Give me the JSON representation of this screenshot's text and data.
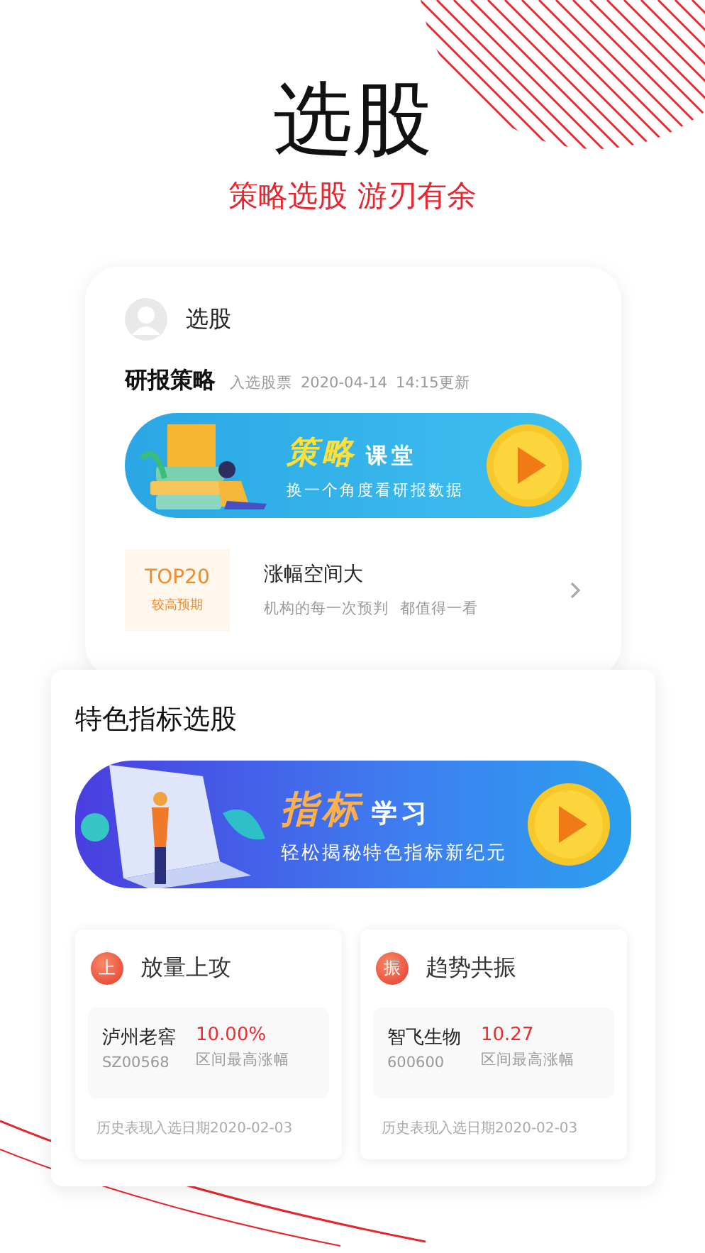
{
  "hero": {
    "title": "选股",
    "subtitle": "策略选股 游刃有余"
  },
  "phone_card": {
    "header": {
      "title": "选股"
    },
    "section": {
      "title": "研报策略",
      "meta": "入选股票",
      "date": "2020-04-14",
      "time": "14:15更新"
    },
    "banner": {
      "highlight": "策略",
      "rest": "课堂",
      "caption": "换一个角度看研报数据"
    },
    "list_item": {
      "badge_title": "TOP20",
      "badge_caption": "较高预期",
      "title": "涨幅空间大",
      "subtitle": "机构的每一次预判",
      "subtitle_2": "都值得一看"
    }
  },
  "feature_card": {
    "title": "特色指标选股",
    "banner": {
      "highlight": "指标",
      "rest": "学习",
      "caption": "轻松揭秘特色指标新纪元"
    },
    "strategies": [
      {
        "icon_char": "上",
        "title": "放量上攻",
        "stock_name": "泸州老窖",
        "stock_code": "SZ00568",
        "value": "10.00%",
        "value_label": "区间最高涨幅",
        "footer": "历史表现入选日期2020-02-03"
      },
      {
        "icon_char": "振",
        "title": "趋势共振",
        "stock_name": "智飞生物",
        "stock_code": "600600",
        "value": "10.27",
        "value_label": "区间最高涨幅",
        "footer": "历史表现入选日期2020-02-03"
      }
    ]
  }
}
